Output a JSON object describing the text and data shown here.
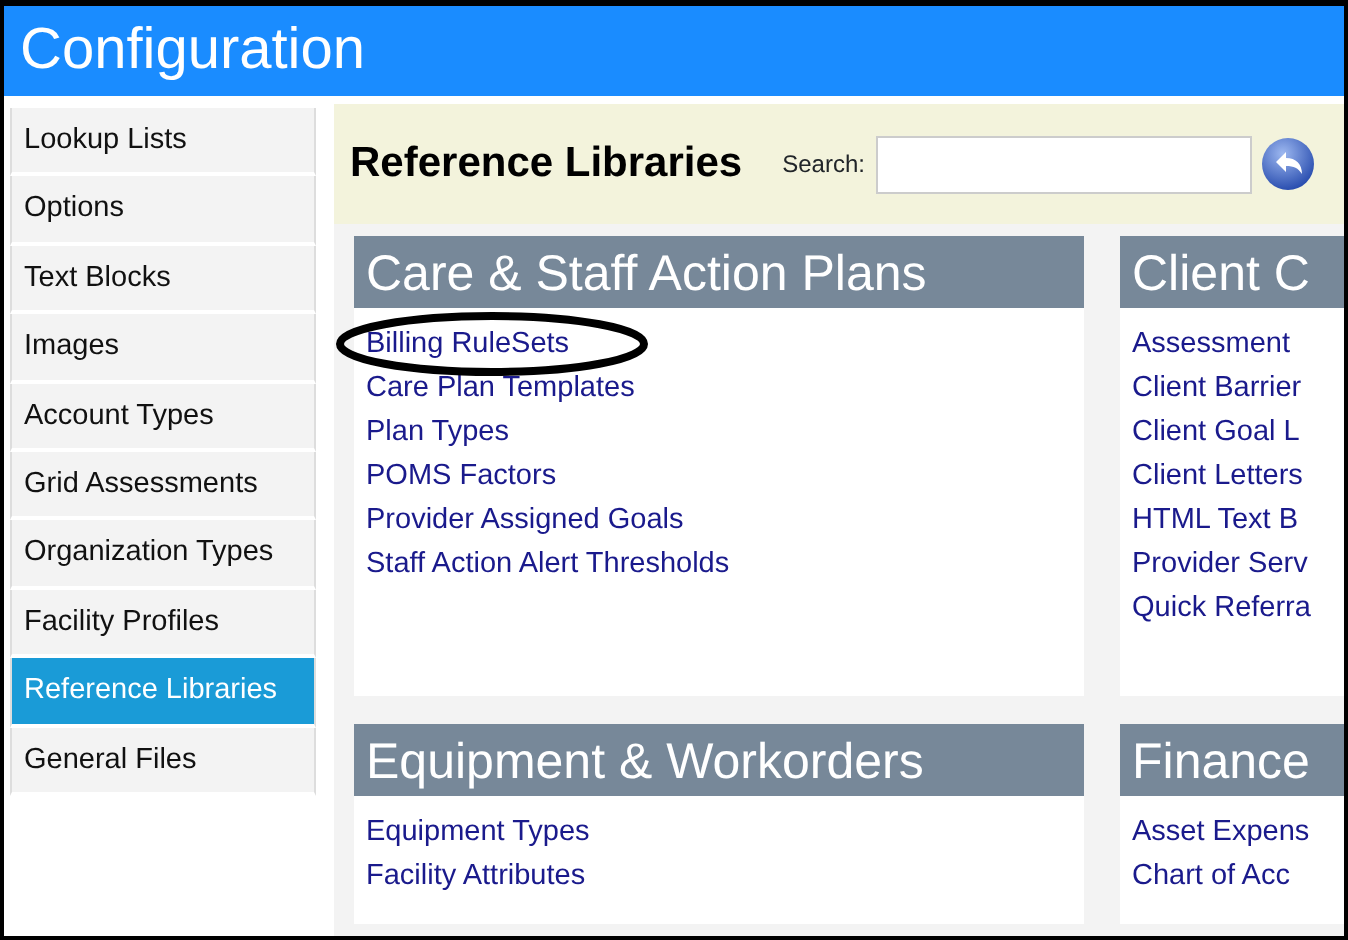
{
  "window": {
    "title": "Configuration"
  },
  "sidebar": {
    "items": [
      {
        "label": "Lookup Lists",
        "selected": false
      },
      {
        "label": "Options",
        "selected": false
      },
      {
        "label": "Text Blocks",
        "selected": false
      },
      {
        "label": "Images",
        "selected": false
      },
      {
        "label": "Account Types",
        "selected": false
      },
      {
        "label": "Grid Assessments",
        "selected": false
      },
      {
        "label": "Organization Types",
        "selected": false
      },
      {
        "label": "Facility Profiles",
        "selected": false
      },
      {
        "label": "Reference Libraries",
        "selected": true
      },
      {
        "label": "General Files",
        "selected": false
      }
    ]
  },
  "header": {
    "title": "Reference Libraries",
    "search_label": "Search:"
  },
  "sections": [
    {
      "title": "Care & Staff Action Plans",
      "items": [
        {
          "label": "Billing RuleSets",
          "circled": true
        },
        {
          "label": "Care Plan Templates",
          "circled": false
        },
        {
          "label": "Plan Types",
          "circled": false
        },
        {
          "label": "POMS Factors",
          "circled": false
        },
        {
          "label": "Provider Assigned Goals",
          "circled": false
        },
        {
          "label": "Staff Action Alert Thresholds",
          "circled": false
        }
      ]
    },
    {
      "title": "Client C",
      "items": [
        {
          "label": "Assessment",
          "circled": false
        },
        {
          "label": "Client Barrier",
          "circled": false
        },
        {
          "label": "Client Goal L",
          "circled": false
        },
        {
          "label": "Client Letters",
          "circled": false
        },
        {
          "label": "HTML Text B",
          "circled": false
        },
        {
          "label": "Provider Serv",
          "circled": false
        },
        {
          "label": "Quick Referra",
          "circled": false
        }
      ]
    },
    {
      "title": "Equipment & Workorders",
      "items": [
        {
          "label": "Equipment Types",
          "circled": false
        },
        {
          "label": "Facility Attributes",
          "circled": false
        }
      ]
    },
    {
      "title": "Finance",
      "items": [
        {
          "label": "Asset Expens",
          "circled": false
        },
        {
          "label": "Chart of Acc",
          "circled": false
        }
      ]
    }
  ]
}
